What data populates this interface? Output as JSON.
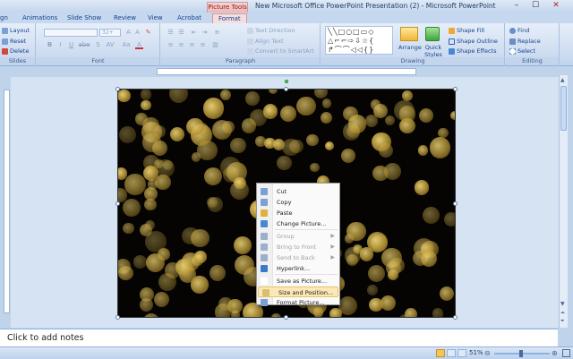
{
  "window": {
    "title": "New Microsoft Office PowerPoint Presentation (2) - Microsoft PowerPoint",
    "contextual_tab_group": "Picture Tools",
    "min": "–",
    "max": "☐",
    "close": "✕"
  },
  "tabs": [
    {
      "label": "gn"
    },
    {
      "label": "Animations"
    },
    {
      "label": "Slide Show"
    },
    {
      "label": "Review"
    },
    {
      "label": "View"
    },
    {
      "label": "Acrobat"
    },
    {
      "label": "Format"
    }
  ],
  "ribbon": {
    "slides": {
      "layout": "Layout",
      "reset": "Reset",
      "delete": "Delete",
      "label": "Slides"
    },
    "font": {
      "size_placeholder": "32+",
      "label": "Font",
      "bold": "B",
      "italic": "I",
      "underline": "U",
      "strike": "abe",
      "shadow": "S",
      "spacing": "AV",
      "case": "Aa",
      "color": "A"
    },
    "paragraph": {
      "text_direction": "Text Direction",
      "align_text": "Align Text",
      "convert": "Convert to SmartArt",
      "label": "Paragraph"
    },
    "drawing": {
      "arrange": "Arrange",
      "quick_styles": "Quick Styles",
      "shape_fill": "Shape Fill",
      "shape_outline": "Shape Outline",
      "shape_effects": "Shape Effects",
      "label": "Drawing"
    },
    "editing": {
      "find": "Find",
      "replace": "Replace",
      "select": "Select",
      "label": "Editing"
    }
  },
  "context_menu": {
    "items": [
      {
        "label": "Cut",
        "enabled": true
      },
      {
        "label": "Copy",
        "enabled": true
      },
      {
        "label": "Paste",
        "enabled": true
      },
      {
        "label": "Change Picture...",
        "enabled": true
      },
      {
        "label": "Group",
        "enabled": false,
        "submenu": true
      },
      {
        "label": "Bring to Front",
        "enabled": false,
        "submenu": true
      },
      {
        "label": "Send to Back",
        "enabled": false,
        "submenu": true
      },
      {
        "label": "Hyperlink...",
        "enabled": true
      },
      {
        "label": "Save as Picture...",
        "enabled": true
      },
      {
        "label": "Size and Position...",
        "enabled": true,
        "highlighted": true
      },
      {
        "label": "Format Picture...",
        "enabled": true
      }
    ]
  },
  "notes": {
    "placeholder": "Click to add notes"
  },
  "status": {
    "zoom": "51%"
  },
  "colors": {
    "accent": "#15428b",
    "ribbon": "#cfddf1",
    "slide_bg": "#050403",
    "gold": "#c9a43a"
  }
}
